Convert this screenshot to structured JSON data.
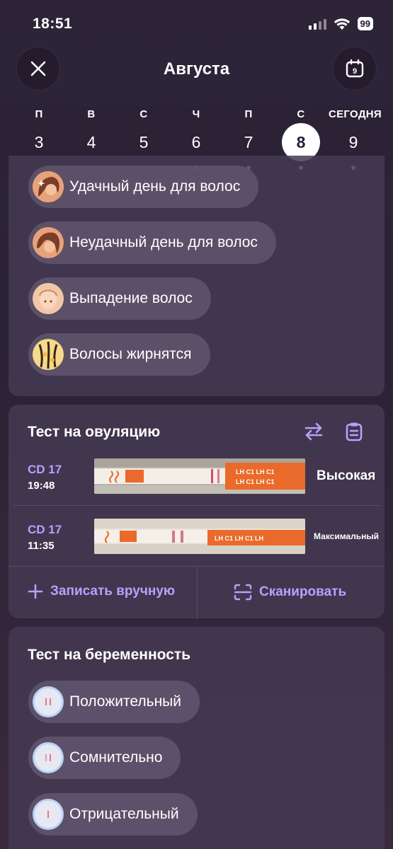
{
  "status": {
    "time": "18:51",
    "battery": "99"
  },
  "header": {
    "month": "Августа",
    "calendar_badge": "9"
  },
  "week": [
    {
      "dow": "П",
      "num": "3",
      "dot": false,
      "selected": false
    },
    {
      "dow": "В",
      "num": "4",
      "dot": false,
      "selected": false
    },
    {
      "dow": "С",
      "num": "5",
      "dot": false,
      "selected": false
    },
    {
      "dow": "Ч",
      "num": "6",
      "dot": true,
      "selected": false
    },
    {
      "dow": "П",
      "num": "7",
      "dot": true,
      "selected": false
    },
    {
      "dow": "С",
      "num": "8",
      "dot": true,
      "selected": true
    },
    {
      "dow": "СЕГОДНЯ",
      "num": "9",
      "dot": true,
      "selected": false
    }
  ],
  "hair": {
    "chips": [
      {
        "label": "Удачный день для волос",
        "icon": "good-hair-day-icon"
      },
      {
        "label": "Неудачный день для волос",
        "icon": "bad-hair-day-icon"
      },
      {
        "label": "Выпадение волос",
        "icon": "hair-loss-icon"
      },
      {
        "label": "Волосы жирнятся",
        "icon": "oily-hair-icon"
      }
    ]
  },
  "ovulation": {
    "title": "Тест на овуляцию",
    "entries": [
      {
        "cd": "CD 17",
        "time": "19:48",
        "result": "Высокая"
      },
      {
        "cd": "CD 17",
        "time": "11:35",
        "result": "Максимальный"
      }
    ],
    "manual_label": "Записать вручную",
    "scan_label": "Сканировать"
  },
  "pregnancy": {
    "title": "Тест на беременность",
    "chips": [
      {
        "label": "Положительный",
        "icon": "positive-test-icon"
      },
      {
        "label": "Сомнительно",
        "icon": "doubtful-test-icon"
      },
      {
        "label": "Отрицательный",
        "icon": "negative-test-icon"
      }
    ]
  },
  "colors": {
    "accent": "#b4a2ff",
    "card": "#443952",
    "chip": "#61556e"
  }
}
